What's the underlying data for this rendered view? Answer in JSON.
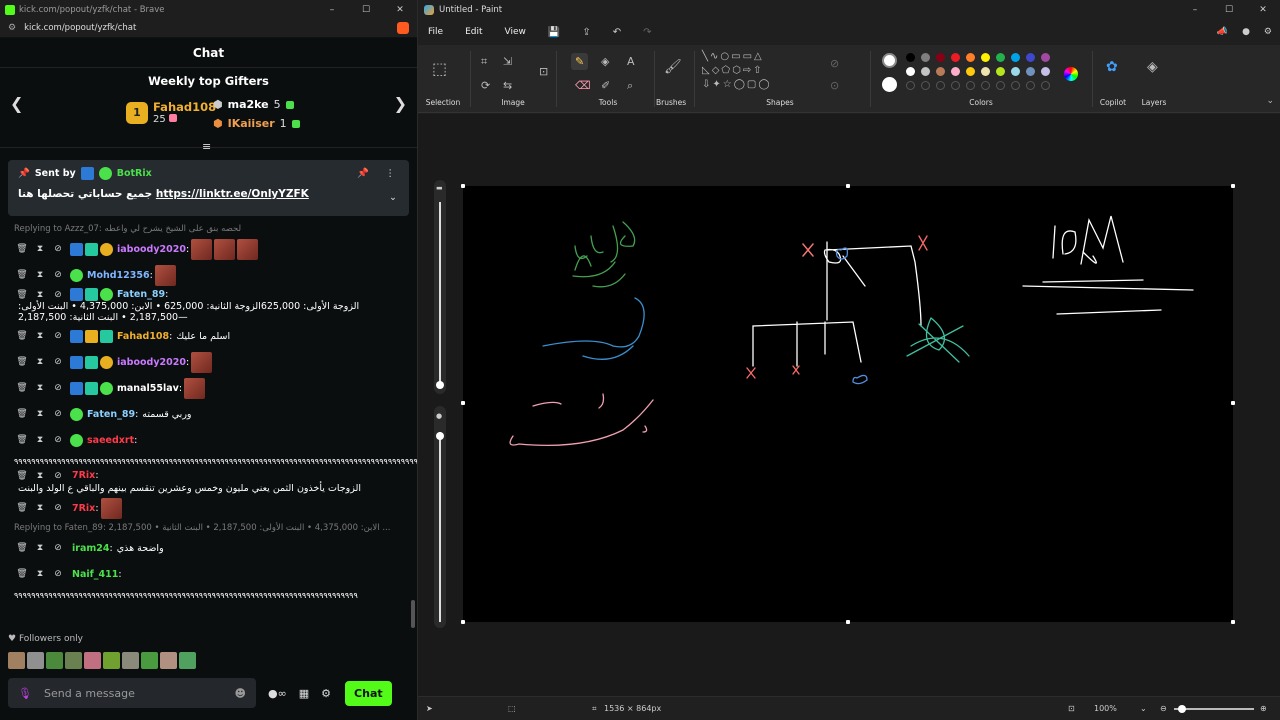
{
  "browser": {
    "title": "kick.com/popout/yzfk/chat - Brave",
    "url": "kick.com/popout/yzfk/chat"
  },
  "chat": {
    "header": "Chat",
    "weekly_title": "Weekly top Gifters",
    "top1": {
      "rank": "1",
      "name": "Fahad108",
      "count": "25"
    },
    "top2": {
      "name": "ma2ke",
      "count": "5"
    },
    "top3": {
      "name": "IKaiiser",
      "count": "1"
    },
    "pinned": {
      "sent_by": "Sent by",
      "bot": "BotRix",
      "text": "جميع حساباتي تحصلها هنا",
      "link": "https://linktr.ee/OnlyYZFK"
    },
    "messages": [
      {
        "reply": "Replying to Azzz_07: لحصه بنق على الشيخ يشرح لي واعطه"
      },
      {
        "user": "iaboody2020",
        "color": "#c97aff",
        "text": "",
        "badges": [
          "pick",
          "sub",
          "one"
        ],
        "emotes": 3
      },
      {
        "user": "Mohd12356",
        "color": "#7fb6ff",
        "text": "",
        "badges": [
          "star"
        ],
        "emotes": 1
      },
      {
        "user": "Faten_89",
        "color": "#8cd0ff",
        "text": "الزوجة الأولى: 625,000الزوجة الثانية: 625,000 • الابن: 4,375,000 • البنت الأولى: 2,187,500 • البنت الثانية: 2,187,500—",
        "badges": [
          "pick",
          "sub",
          "star"
        ],
        "emotes": 0
      },
      {
        "user": "Fahad108",
        "color": "#f0b030",
        "text": "اسلم ما عليك",
        "badges": [
          "pick",
          "crown",
          "sub"
        ],
        "emotes": 0
      },
      {
        "user": "iaboody2020",
        "color": "#c97aff",
        "text": "",
        "badges": [
          "pick",
          "sub",
          "one"
        ],
        "emotes": 1
      },
      {
        "user": "manal55lav",
        "color": "#ffffff",
        "text": "",
        "badges": [
          "pick",
          "sub",
          "star"
        ],
        "emotes": 1
      },
      {
        "user": "Faten_89",
        "color": "#8cd0ff",
        "text": "وربي قسمته",
        "badges": [
          "star"
        ],
        "emotes": 0
      },
      {
        "user": "saeedxrt",
        "color": "#ff3b4b",
        "text": "",
        "badges": [
          "star"
        ],
        "emotes": 0
      },
      {
        "long": "٩٩٩٩٩٩٩٩٩٩٩٩٩٩٩٩٩٩٩٩٩٩٩٩٩٩٩٩٩٩٩٩٩٩٩٩٩٩٩٩٩٩٩٩٩٩٩٩٩٩٩٩٩٩٩٩٩٩٩٩٩٩٩٩٩٩٩٩٩٩٩٩٩٩٩٩٩٩٩٩٩٩٩٩٩٩٩٩٩٩٩٩٩٩"
      },
      {
        "user": "7Rix",
        "color": "#ff3b4b",
        "text": "الزوجات يأخذون الثمن يعني مليون وخمس وعشرين تنقسم بينهم والباقي ع الولد والبنت",
        "badges": [],
        "emotes": 0
      },
      {
        "user": "7Rix",
        "color": "#ff3b4b",
        "text": "",
        "badges": [],
        "emotes": 1
      },
      {
        "reply": "Replying to Faten_89: 2,187,500 • الابن: 4,375,000 • البنت الأولى: 2,187,500 • البنت الثانية ..."
      },
      {
        "user": "iram24",
        "color": "#4be14b",
        "text": "واضحة هذي",
        "badges": [],
        "emotes": 0
      },
      {
        "user": "Naif_411",
        "color": "#4be14b",
        "text": "",
        "badges": [],
        "emotes": 0
      },
      {
        "long": "٩٩٩٩٩٩٩٩٩٩٩٩٩٩٩٩٩٩٩٩٩٩٩٩٩٩٩٩٩٩٩٩٩٩٩٩٩٩٩٩٩٩٩٩٩٩٩٩٩٩٩٩٩٩٩٩٩٩٩٩٩٩٩٩٩٩٩٩٩٩٩٩٩٩٩٩٩٩٩٩"
      }
    ],
    "followers_only": "Followers only",
    "send_placeholder": "Send a message",
    "chat_button": "Chat"
  },
  "paint": {
    "title": "Untitled - Paint",
    "menu": [
      "File",
      "Edit",
      "View"
    ],
    "groups": {
      "selection": "Selection",
      "image": "Image",
      "tools": "Tools",
      "brushes": "Brushes",
      "shapes": "Shapes",
      "colors": "Colors",
      "copilot": "Copilot",
      "layers": "Layers"
    },
    "palette": [
      "#000000",
      "#7f7f7f",
      "#880015",
      "#ed1c24",
      "#ff7f27",
      "#fff200",
      "#22b14c",
      "#00a2e8",
      "#3f48cc",
      "#a349a4",
      "#ffffff",
      "#c3c3c3",
      "#b97a57",
      "#ffaec9",
      "#ffc90e",
      "#efe4b0",
      "#b5e61d",
      "#99d9ea",
      "#7092be",
      "#c8bfe7"
    ],
    "status": {
      "size": "1536 × 864px",
      "zoom": "100%"
    },
    "drawing_text": [
      "مقبول",
      "ولد",
      "بنت",
      "10M"
    ]
  }
}
